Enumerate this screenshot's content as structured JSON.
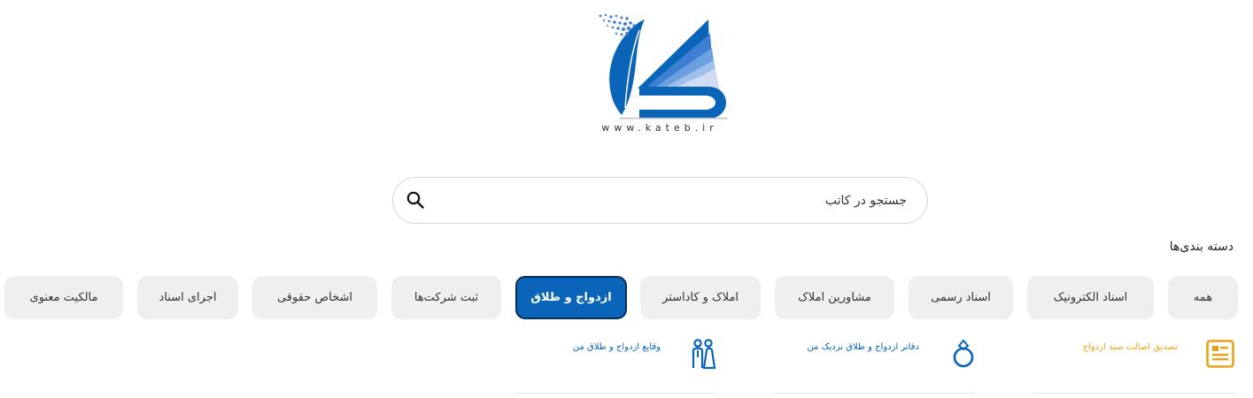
{
  "logo": {
    "url_text": "www.kateb.ir"
  },
  "search": {
    "placeholder": "جستجو در کاتب"
  },
  "categories": {
    "title": "دسته بندی‌ها",
    "items": [
      {
        "label": "همه"
      },
      {
        "label": "اسناد الکترونیک"
      },
      {
        "label": "اسناد رسمی"
      },
      {
        "label": "مشاورین املاک"
      },
      {
        "label": "املاک و کاداستر"
      },
      {
        "label": "ازدواج و طلاق",
        "active": true
      },
      {
        "label": "ثبت شرکت‌ها"
      },
      {
        "label": "اشخاص حقوقی"
      },
      {
        "label": "اجرای اسناد"
      },
      {
        "label": "مالکیت معنوی"
      }
    ]
  },
  "services": [
    {
      "label": "تصدیق اصالت سند ازدواج",
      "icon": "document-certificate-icon",
      "color": "#e8a317"
    },
    {
      "label": "دفاتر ازدواج و طلاق نزدیک من",
      "icon": "ring-icon",
      "color": "#0a64b8"
    },
    {
      "label": "وقایع ازدواج و طلاق من",
      "icon": "couple-icon",
      "color": "#0a64b8"
    }
  ],
  "colors": {
    "brand": "#0a64b8",
    "pill_bg": "#efeff1",
    "accent_orange": "#e8a317"
  }
}
